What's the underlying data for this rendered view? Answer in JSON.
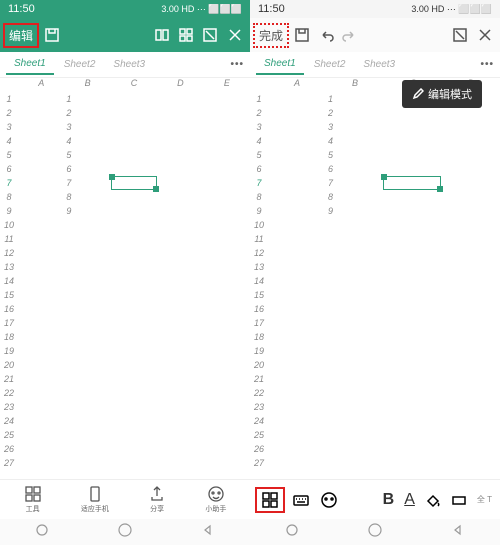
{
  "status": {
    "time": "11:50",
    "indicators": "3.00 HD ⋯ ⬜⬜⬜"
  },
  "left": {
    "appbar": {
      "edit_label": "编辑"
    },
    "sheets": {
      "tabs": [
        "Sheet1",
        "Sheet2",
        "Sheet3"
      ],
      "active": 0
    },
    "columns": [
      "A",
      "B",
      "C",
      "D",
      "E"
    ],
    "rows": [
      1,
      2,
      3,
      4,
      5,
      6,
      7,
      8,
      9,
      10,
      11,
      12,
      13,
      14,
      15,
      16,
      17,
      18,
      19,
      20,
      21,
      22,
      23,
      24,
      25,
      26,
      27
    ],
    "colB_values": [
      "1",
      "2",
      "3",
      "4",
      "5",
      "6",
      "7",
      "8",
      "9"
    ],
    "active_row": 7,
    "bottom": {
      "tools": "工具",
      "template": "适应手机",
      "share": "分享",
      "assistant": "小助手"
    }
  },
  "right": {
    "appbar": {
      "done_label": "完成"
    },
    "sheets": {
      "tabs": [
        "Sheet1",
        "Sheet2",
        "Sheet3"
      ],
      "active": 0
    },
    "edit_mode_label": "编辑模式",
    "columns": [
      "A",
      "B",
      "C",
      "D"
    ],
    "rows": [
      1,
      2,
      3,
      4,
      5,
      6,
      7,
      8,
      9,
      10,
      11,
      12,
      13,
      14,
      15,
      16,
      17,
      18,
      19,
      20,
      21,
      22,
      23,
      24,
      25,
      26,
      27
    ],
    "colB_values": [
      "1",
      "2",
      "3",
      "4",
      "5",
      "6",
      "7",
      "8",
      "9"
    ],
    "active_row": 7,
    "bottom": {
      "keyboard": "全 T"
    }
  }
}
